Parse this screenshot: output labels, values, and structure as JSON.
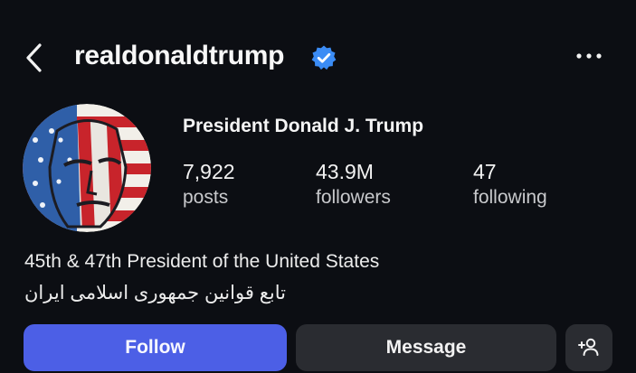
{
  "header": {
    "username": "realdonaldtrump",
    "verified": true,
    "back_icon": "chevron-left-icon",
    "more_icon": "ellipsis-icon"
  },
  "profile": {
    "display_name": "President Donald J. Trump",
    "stats": [
      {
        "value": "7,922",
        "label": "posts"
      },
      {
        "value": "43.9M",
        "label": "followers"
      },
      {
        "value": "47",
        "label": "following"
      }
    ],
    "bio_lines": [
      "45th & 47th President of the United States",
      "تابع قوانین جمهوری اسلامی ایران"
    ]
  },
  "actions": {
    "follow_label": "Follow",
    "message_label": "Message",
    "add_user_icon": "add-user-icon"
  },
  "colors": {
    "background": "#0c0e13",
    "follow_button": "#4c5fe6",
    "secondary_button": "#2a2c31",
    "verified_badge": "#3b8cf5"
  }
}
